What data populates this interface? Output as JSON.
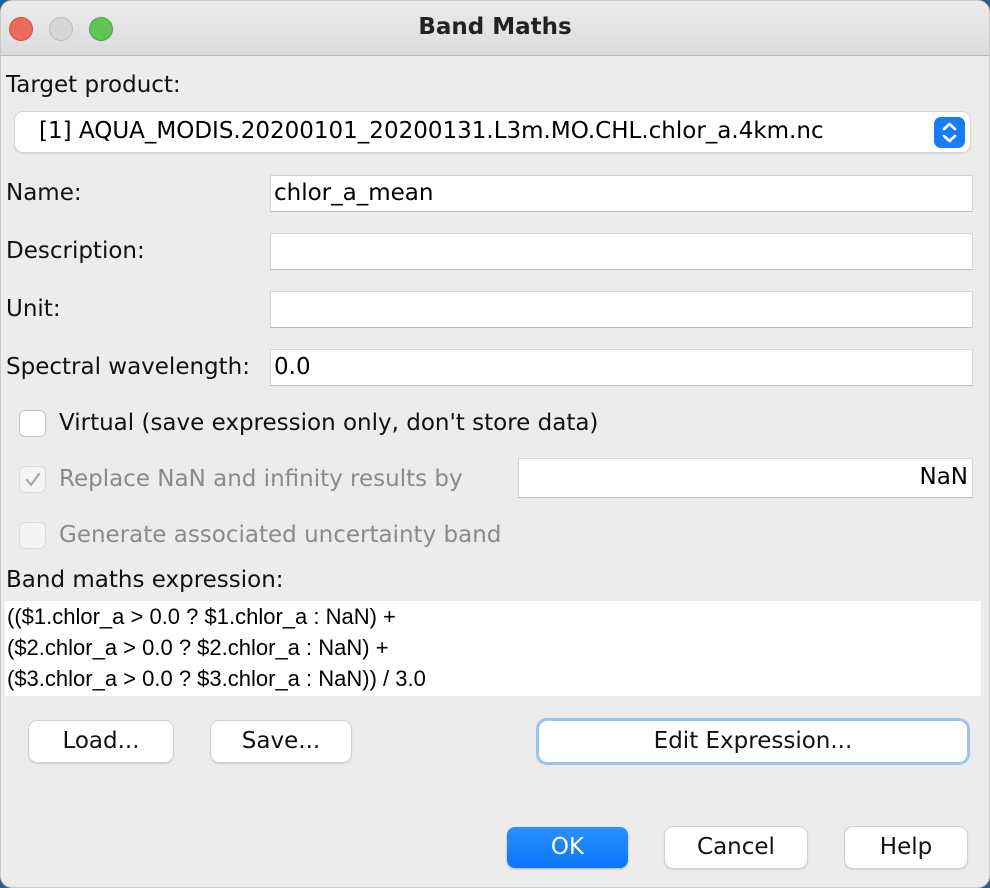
{
  "window": {
    "title": "Band Maths",
    "controls": [
      "close",
      "minimize",
      "maximize"
    ]
  },
  "target_product": {
    "label": "Target product:",
    "selected": "[1] AQUA_MODIS.20200101_20200131.L3m.MO.CHL.chlor_a.4km.nc"
  },
  "fields": {
    "name": {
      "label": "Name:",
      "value": "chlor_a_mean"
    },
    "description": {
      "label": "Description:",
      "value": ""
    },
    "unit": {
      "label": "Unit:",
      "value": ""
    },
    "spectral_wavelength": {
      "label": "Spectral wavelength:",
      "value": "0.0"
    }
  },
  "options": {
    "virtual": {
      "label": "Virtual (save expression only, don't store data)",
      "checked": false,
      "enabled": true
    },
    "replace_nan": {
      "label": "Replace NaN and infinity results by",
      "checked": true,
      "enabled": false,
      "value": "NaN"
    },
    "uncertainty": {
      "label": "Generate associated uncertainty band",
      "checked": false,
      "enabled": false
    }
  },
  "expression": {
    "label": "Band maths expression:",
    "lines": [
      "(($1.chlor_a > 0.0 ? $1.chlor_a : NaN) +",
      "($2.chlor_a > 0.0 ? $2.chlor_a : NaN) +",
      "($3.chlor_a > 0.0 ? $3.chlor_a : NaN)) / 3.0"
    ]
  },
  "buttons": {
    "load": "Load...",
    "save": "Save...",
    "edit_expression": "Edit Expression...",
    "ok": "OK",
    "cancel": "Cancel",
    "help": "Help"
  },
  "colors": {
    "accent": "#0a76f7",
    "background": "#ececec"
  }
}
